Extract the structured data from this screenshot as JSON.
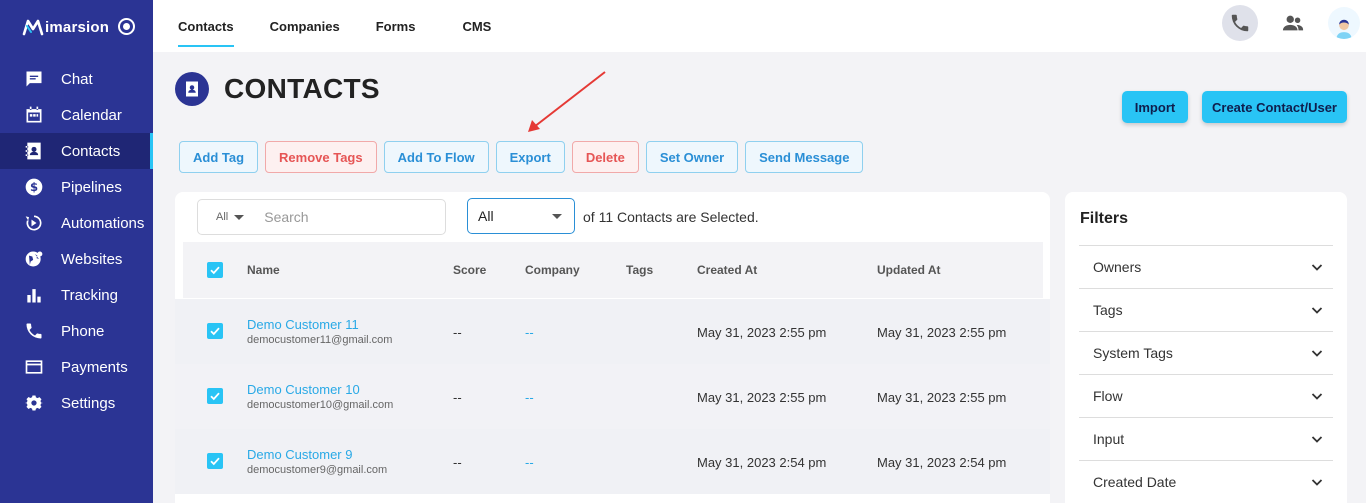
{
  "brand": {
    "name": "imarsion"
  },
  "sidebar": {
    "items": [
      {
        "label": "Chat",
        "icon": "chat-icon"
      },
      {
        "label": "Calendar",
        "icon": "calendar-icon"
      },
      {
        "label": "Contacts",
        "icon": "contacts-icon",
        "active": true
      },
      {
        "label": "Pipelines",
        "icon": "dollar-icon"
      },
      {
        "label": "Automations",
        "icon": "automation-icon"
      },
      {
        "label": "Websites",
        "icon": "globe-icon"
      },
      {
        "label": "Tracking",
        "icon": "bar-chart-icon"
      },
      {
        "label": "Phone",
        "icon": "phone-icon"
      },
      {
        "label": "Payments",
        "icon": "credit-card-icon"
      },
      {
        "label": "Settings",
        "icon": "gear-icon"
      }
    ]
  },
  "topbar": {
    "tabs": [
      {
        "label": "Contacts",
        "active": true
      },
      {
        "label": "Companies"
      },
      {
        "label": "Forms"
      },
      {
        "label": "CMS"
      }
    ]
  },
  "page": {
    "title": "CONTACTS"
  },
  "header_buttons": {
    "import": "Import",
    "create": "Create Contact/User"
  },
  "actions": {
    "add_tag": "Add Tag",
    "remove_tags": "Remove Tags",
    "add_to_flow": "Add To Flow",
    "export": "Export",
    "delete": "Delete",
    "set_owner": "Set Owner",
    "send_message": "Send Message"
  },
  "search": {
    "scope": "All",
    "placeholder": "Search"
  },
  "selection": {
    "value": "All",
    "text": "of 11 Contacts are Selected."
  },
  "table": {
    "columns": {
      "name": "Name",
      "score": "Score",
      "company": "Company",
      "tags": "Tags",
      "created": "Created At",
      "updated": "Updated At"
    },
    "rows": [
      {
        "name": "Demo Customer 11",
        "email": "democustomer11@gmail.com",
        "score": "--",
        "company": "--",
        "tags": "",
        "created": "May 31, 2023 2:55 pm",
        "updated": "May 31, 2023 2:55 pm"
      },
      {
        "name": "Demo Customer 10",
        "email": "democustomer10@gmail.com",
        "score": "--",
        "company": "--",
        "tags": "",
        "created": "May 31, 2023 2:55 pm",
        "updated": "May 31, 2023 2:55 pm"
      },
      {
        "name": "Demo Customer 9",
        "email": "democustomer9@gmail.com",
        "score": "--",
        "company": "--",
        "tags": "",
        "created": "May 31, 2023 2:54 pm",
        "updated": "May 31, 2023 2:54 pm"
      }
    ]
  },
  "filters": {
    "title": "Filters",
    "items": [
      "Owners",
      "Tags",
      "System Tags",
      "Flow",
      "Input",
      "Created Date"
    ]
  },
  "colors": {
    "sidebar": "#2b3494",
    "accent": "#29c4f5",
    "link": "#29a9e6",
    "danger": "#e65555"
  }
}
